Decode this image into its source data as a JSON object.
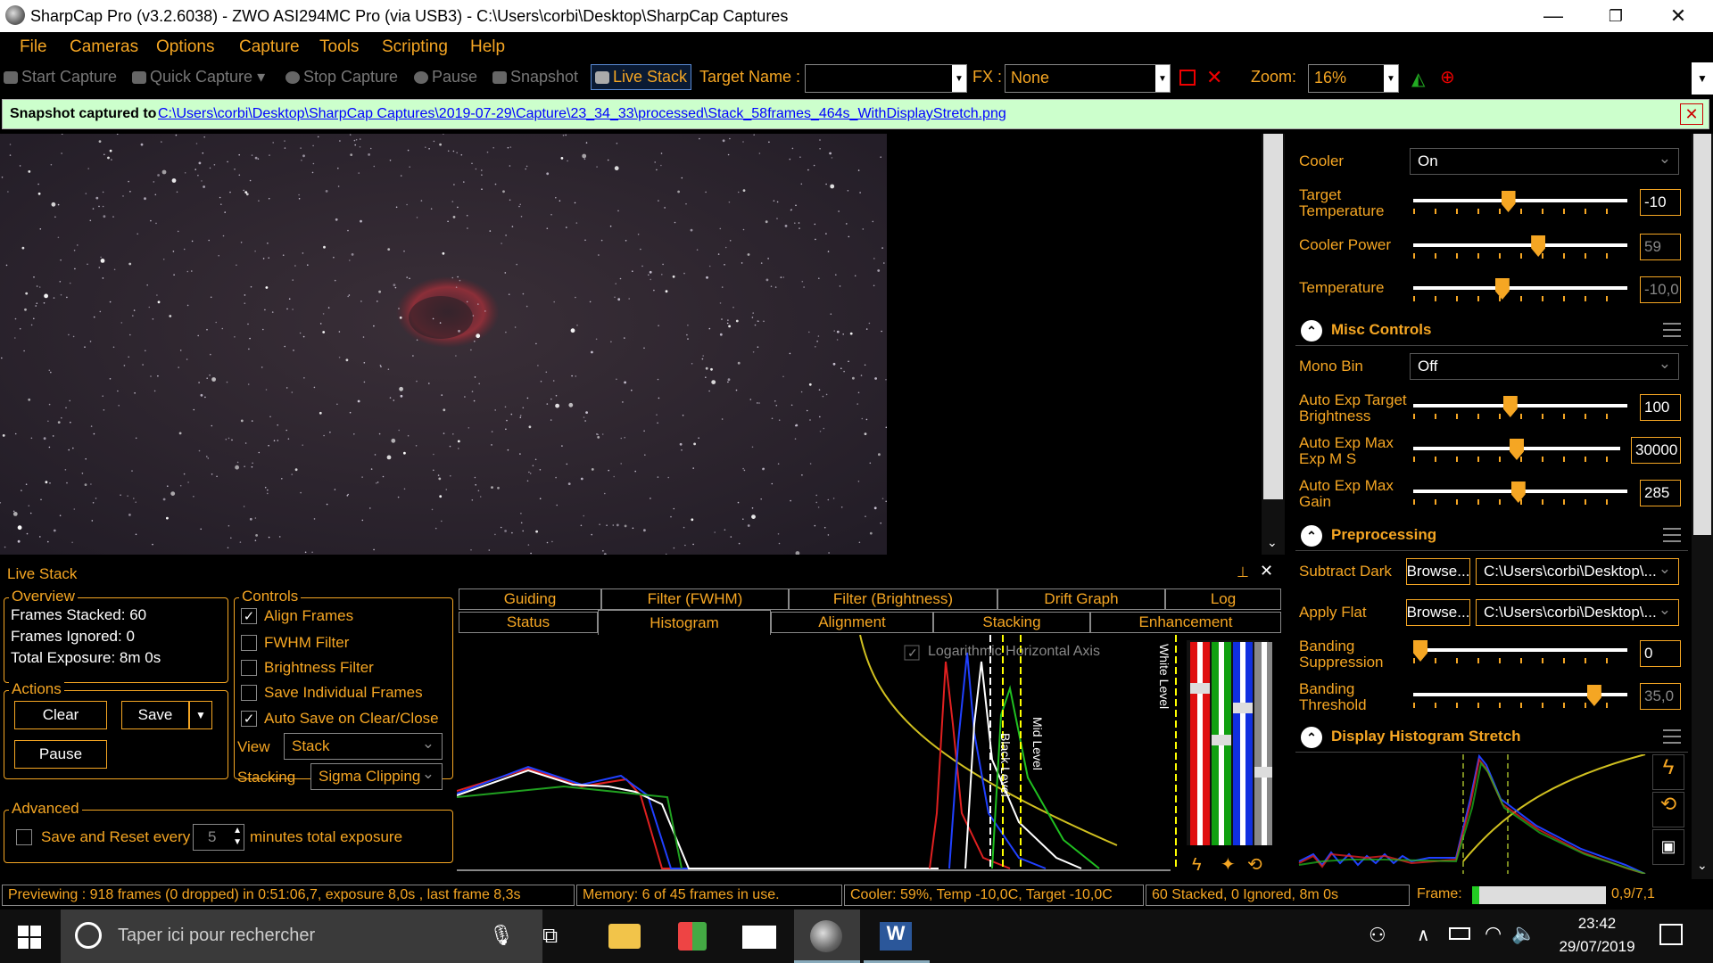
{
  "window": {
    "title": "SharpCap Pro (v3.2.6038) - ZWO ASI294MC Pro (via USB3) - C:\\Users\\corbi\\Desktop\\SharpCap Captures",
    "minimize": "—",
    "maximize": "❐",
    "close": "✕"
  },
  "menu": [
    "File",
    "Cameras",
    "Options",
    "Capture",
    "Tools",
    "Scripting",
    "Help"
  ],
  "toolbar": {
    "start_capture": "Start Capture",
    "quick_capture": "Quick Capture",
    "stop_capture": "Stop Capture",
    "pause": "Pause",
    "snapshot": "Snapshot",
    "live_stack": "Live Stack",
    "target_name_label": "Target Name :",
    "target_name_value": "",
    "fx_label": "FX :",
    "fx_value": "None",
    "zoom_label": "Zoom:",
    "zoom_value": "16%"
  },
  "notification": {
    "label": "Snapshot captured to",
    "path": "C:\\Users\\corbi\\Desktop\\SharpCap Captures\\2019-07-29\\Capture\\23_34_33\\processed\\Stack_58frames_464s_WithDisplayStretch.png"
  },
  "right_panel": {
    "cooler": {
      "label": "Cooler",
      "value": "On"
    },
    "target_temperature": {
      "label": "Target Temperature",
      "value": "-10",
      "level": 0.44
    },
    "cooler_power": {
      "label": "Cooler Power",
      "value": "59",
      "level": 0.59
    },
    "temperature": {
      "label": "Temperature",
      "value": "-10,0",
      "level": 0.41
    },
    "misc_controls": {
      "title": "Misc Controls"
    },
    "mono_bin": {
      "label": "Mono Bin",
      "value": "Off"
    },
    "auto_exp_target": {
      "label": "Auto Exp Target Brightness",
      "value": "100",
      "level": 0.45
    },
    "auto_exp_max": {
      "label": "Auto Exp Max Exp M S",
      "value": "30000",
      "level": 0.5
    },
    "auto_exp_gain": {
      "label": "Auto Exp Max Gain",
      "value": "285",
      "level": 0.49
    },
    "preprocessing": {
      "title": "Preprocessing"
    },
    "subtract_dark": {
      "label": "Subtract Dark",
      "browse": "Browse...",
      "value": "C:\\Users\\corbi\\Desktop\\..."
    },
    "apply_flat": {
      "label": "Apply Flat",
      "browse": "Browse...",
      "value": "C:\\Users\\corbi\\Desktop\\..."
    },
    "banding_suppression": {
      "label": "Banding Suppression",
      "value": "0",
      "level": 0.0
    },
    "banding_threshold": {
      "label": "Banding Threshold",
      "value": "35,0",
      "level": 0.87
    },
    "display_stretch": {
      "title": "Display Histogram Stretch"
    }
  },
  "live_stack": {
    "title": "Live Stack",
    "overview": {
      "title": "Overview",
      "frames_stacked": "Frames Stacked:  60",
      "frames_ignored": "Frames Ignored:  0",
      "total_exposure": "Total Exposure:   8m 0s"
    },
    "actions": {
      "title": "Actions",
      "clear": "Clear",
      "save": "Save",
      "pause": "Pause"
    },
    "controls": {
      "title": "Controls",
      "align_frames": "Align Frames",
      "fwhm_filter": "FWHM Filter",
      "brightness_filter": "Brightness Filter",
      "save_individual": "Save Individual Frames",
      "auto_save": "Auto Save on Clear/Close",
      "view_label": "View",
      "view_value": "Stack",
      "stacking_label": "Stacking",
      "stacking_value": "Sigma Clipping"
    },
    "advanced": {
      "title": "Advanced",
      "save_reset": "Save and Reset every",
      "minutes_value": "5",
      "minutes_label": "minutes total exposure"
    },
    "tabs_row1": [
      "Guiding",
      "Filter (FWHM)",
      "Filter (Brightness)",
      "Drift Graph",
      "Log"
    ],
    "tabs_row2": [
      "Status",
      "Histogram",
      "Alignment",
      "Stacking",
      "Enhancement"
    ],
    "histogram": {
      "log_axis": "Logarithmic Horizontal Axis",
      "white_level": "White Level",
      "mid_level": "Mid Level",
      "black_level": "Black Level"
    }
  },
  "status": {
    "previewing": "Previewing : 918 frames (0 dropped) in 0:51:06,7, exposure 8,0s , last frame 8,3s",
    "memory": "Memory: 6 of 45 frames in use.",
    "cooler": "Cooler: 59%, Temp -10,0C, Target -10,0C",
    "stacked": "60 Stacked, 0 Ignored, 8m 0s",
    "frame_label": "Frame:",
    "frame_value": "0,9/7,1"
  },
  "taskbar": {
    "search_placeholder": "Taper ici pour rechercher",
    "time": "23:42",
    "date": "29/07/2019"
  },
  "colors": {
    "accent": "#f5a623",
    "notify_bg": "#ccffcc",
    "link": "#0000ff"
  }
}
